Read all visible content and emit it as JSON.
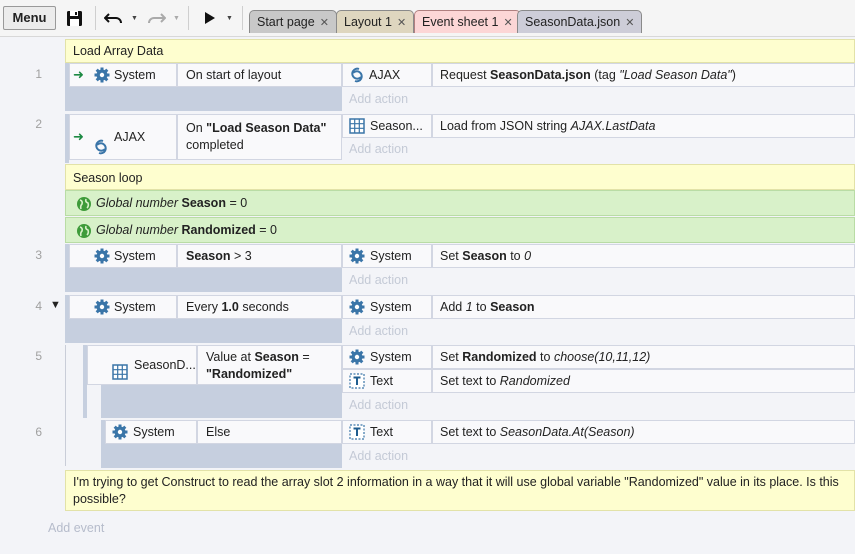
{
  "toolbar": {
    "menu_label": "Menu",
    "tabs": [
      {
        "label": "Start page"
      },
      {
        "label": "Layout 1"
      },
      {
        "label": "Event sheet 1"
      },
      {
        "label": "SeasonData.json"
      }
    ]
  },
  "colors": {
    "comment_bg": "#fefecf",
    "global_var_bg": "#d8f1c9",
    "active_tab": "#fcd6d6",
    "tab_inactive": "#c8c8c8",
    "layout_tab": "#ded6bf",
    "json_tab": "#cdcdd8"
  },
  "sheet": {
    "add_action_label": "Add action",
    "add_event_label": "Add event",
    "comment_load": "Load Array Data",
    "comment_loop": "Season loop",
    "comment_question": "I'm trying to get Construct to read the array slot 2 information in a way that it will use global variable \"Randomized\" value in its place. Is this possible?",
    "global_vars": [
      {
        "prefix": "Global number",
        "name": "Season",
        "suffix": "= 0"
      },
      {
        "prefix": "Global number",
        "name": "Randomized",
        "suffix": "= 0"
      }
    ],
    "events": [
      {
        "num": "1",
        "cond_obj": "System",
        "cond_text": "On start of layout",
        "actions": [
          {
            "obj": "AJAX",
            "pre": "Request",
            "bold": "SeasonData.json",
            "mid": "(tag",
            "ital": "\"Load Season Data\"",
            "post": ")"
          }
        ]
      },
      {
        "num": "2",
        "cond_obj": "AJAX",
        "cond_pre": "On",
        "cond_bold": "\"Load Season Data\"",
        "cond_post": "completed",
        "actions": [
          {
            "obj": "Season...",
            "pre": "Load from JSON string",
            "ital": "AJAX.LastData"
          }
        ]
      },
      {
        "num": "3",
        "cond_obj": "System",
        "cond_bold": "Season",
        "cond_post": "> 3",
        "actions": [
          {
            "obj": "System",
            "pre": "Set",
            "bold": "Season",
            "mid": "to",
            "ital": "0"
          }
        ]
      },
      {
        "num": "4",
        "cond_obj": "System",
        "cond_pre": "Every",
        "cond_bold": "1.0",
        "cond_post": "seconds",
        "actions": [
          {
            "obj": "System",
            "pre": "Add",
            "ital": "1",
            "mid": "to",
            "bold": "Season"
          }
        ]
      },
      {
        "num": "5",
        "cond_obj": "SeasonD...",
        "cond_pre": "Value at",
        "cond_bold": "Season",
        "cond_post": "=",
        "cond_bold2": "\"Randomized\"",
        "actions": [
          {
            "obj": "System",
            "pre": "Set",
            "bold": "Randomized",
            "mid": "to",
            "ital": "choose(10,11,12)"
          },
          {
            "obj": "Text",
            "pre": "Set text to",
            "ital": "Randomized"
          }
        ]
      },
      {
        "num": "6",
        "cond_obj": "System",
        "cond_text": "Else",
        "actions": [
          {
            "obj": "Text",
            "pre": "Set text to",
            "ital": "SeasonData.At(Season)"
          }
        ]
      }
    ]
  }
}
